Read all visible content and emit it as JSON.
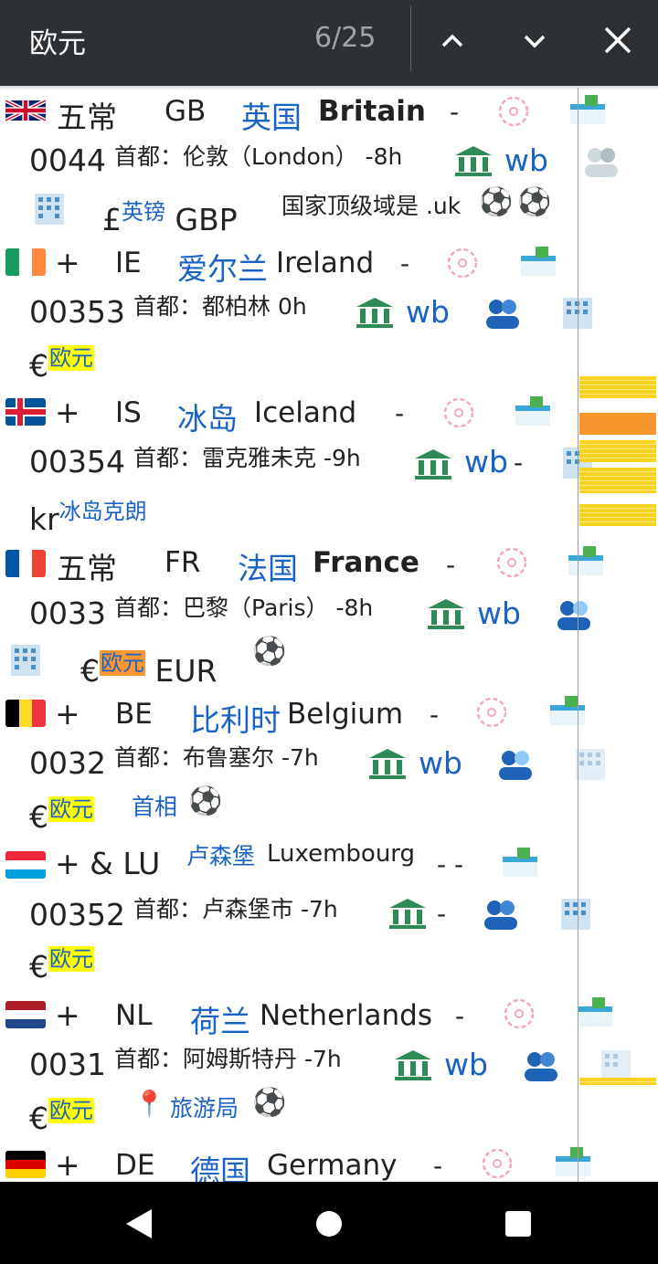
{
  "find_bar": {
    "query": "欧元",
    "match_count": "6/25",
    "prev_icon": "chevron-up-icon",
    "next_icon": "chevron-down-icon",
    "close_icon": "close-icon"
  },
  "colors": {
    "find_bar_bg": "#2e3134",
    "link": "#1a63c6",
    "highlight": "#ffff00",
    "active_highlight": "#ff9632"
  },
  "entries": [
    {
      "id": "gb",
      "prefix": "五常",
      "code": "GB",
      "name_cn": "英国",
      "name_en": "Britain",
      "dash": "-",
      "dial": "0044",
      "capital": "首都：伦敦（London） -8h",
      "wb": "wb",
      "currency_symbol": "£",
      "currency_cn": "英镑",
      "currency_code": "GBP",
      "note": "国家顶级域是 .uk"
    },
    {
      "id": "ie",
      "prefix": "+",
      "code": "IE",
      "name_cn": "爱尔兰",
      "name_en": "Ireland",
      "dash": "-",
      "dial": "00353",
      "capital": "首都：都柏林 0h",
      "wb": "wb",
      "currency_symbol": "€",
      "currency_cn": "欧元"
    },
    {
      "id": "is",
      "prefix": "+",
      "code": "IS",
      "name_cn": "冰岛",
      "name_en": "Iceland",
      "dash": "-",
      "dial": "00354",
      "capital": "首都：雷克雅未克 -9h",
      "wb": "wb",
      "wb_dash": "-",
      "currency_symbol": "kr",
      "currency_cn": "冰岛克朗"
    },
    {
      "id": "fr",
      "prefix": "五常",
      "code": "FR",
      "name_cn": "法国",
      "name_en": "France",
      "dash": "-",
      "dial": "0033",
      "capital": "首都：巴黎（Paris） -8h",
      "wb": "wb",
      "currency_symbol": "€",
      "currency_cn": "欧元",
      "currency_code": "EUR"
    },
    {
      "id": "be",
      "prefix": "+",
      "code": "BE",
      "name_cn": "比利时",
      "name_en": "Belgium",
      "dash": "-",
      "dial": "0032",
      "capital": "首都：布鲁塞尔 -7h",
      "wb": "wb",
      "currency_symbol": "€",
      "currency_cn": "欧元",
      "pm_link": "首相"
    },
    {
      "id": "lu",
      "prefix": "+ & LU",
      "name_cn": "卢森堡",
      "name_en": "Luxembourg",
      "dash": "- -",
      "dial": "00352",
      "capital": "首都：卢森堡市 -7h",
      "wb_dash": "-",
      "currency_symbol": "€",
      "currency_cn": "欧元"
    },
    {
      "id": "nl",
      "prefix": "+",
      "code": "NL",
      "name_cn": "荷兰",
      "name_en": "Netherlands",
      "dash": "-",
      "dial": "0031",
      "capital": "首都：阿姆斯特丹 -7h",
      "wb": "wb",
      "currency_symbol": "€",
      "currency_cn": "欧元",
      "tourism_link": "旅游局"
    },
    {
      "id": "de",
      "prefix": "+",
      "code": "DE",
      "name_cn": "德国",
      "name_en": "Germany",
      "dash": "-"
    }
  ],
  "nav": {
    "back_icon": "back-triangle-icon",
    "home_icon": "home-circle-icon",
    "recents_icon": "recents-square-icon"
  }
}
